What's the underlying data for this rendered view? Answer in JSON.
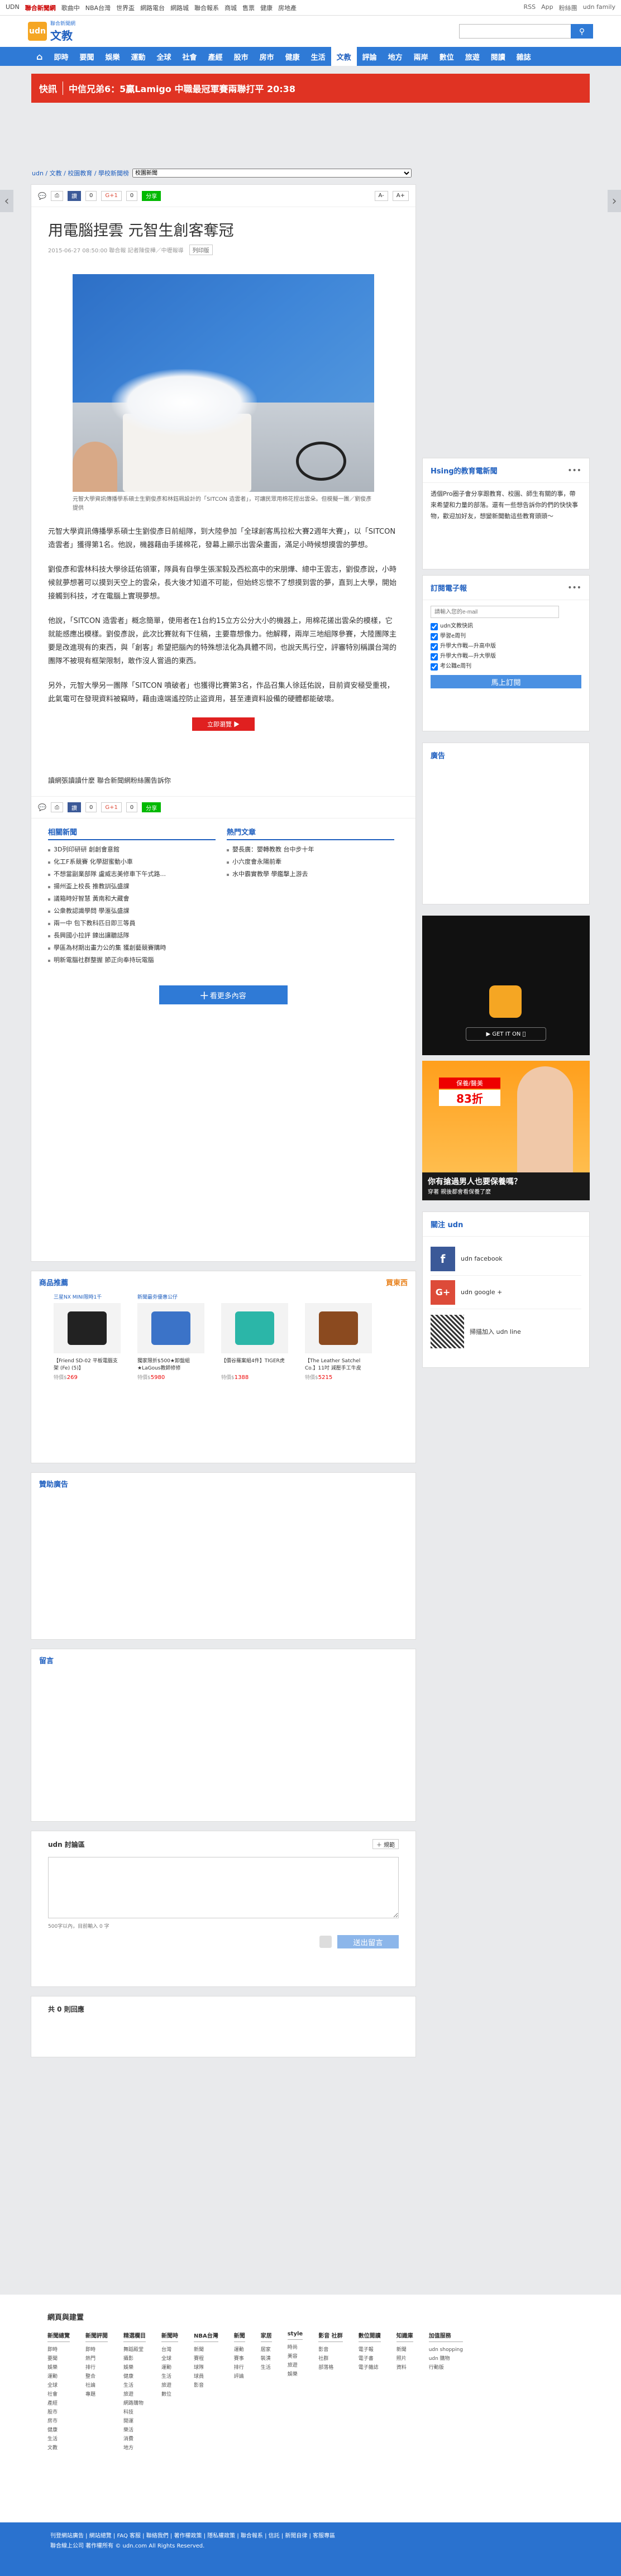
{
  "topbar": {
    "links": [
      "UDN",
      "聯合新聞網",
      "歌曲中",
      "NBA台灣",
      "世界盃",
      "網路電台",
      "網路城",
      "聯合報系",
      "商城",
      "售票",
      "健康",
      "房地產"
    ],
    "right": [
      "RSS",
      "App",
      "粉絲團",
      "udn family"
    ]
  },
  "masthead": {
    "logo_small": "聯合新聞網",
    "section": "文教",
    "search_icon": "search-icon"
  },
  "nav": [
    "即時",
    "要聞",
    "娛樂",
    "運動",
    "全球",
    "社會",
    "產經",
    "股市",
    "房市",
    "健康",
    "生活",
    "文教",
    "評論",
    "地方",
    "兩岸",
    "數位",
    "旅遊",
    "閱讀",
    "雜誌"
  ],
  "nav_active": "文教",
  "breaking": {
    "tag": "快訊",
    "text": "中信兄弟6：5贏Lamigo 中職最冠軍賽兩聯打平 20:38"
  },
  "breadcrumb": {
    "path": "udn / 文教 / 校園教育 / 學校新聞榜",
    "select": "校園新聞"
  },
  "share": {
    "fb": "讚",
    "fb_count": "0",
    "gp_count": "0",
    "line": "分享",
    "font_small": "A-",
    "font_large": "A+"
  },
  "article": {
    "title": "用電腦捏雲 元智生創客奪冠",
    "meta": "2015-06-27 08:50:00 聯合報 記者陳俊樺／中壢報導",
    "print": "列印版",
    "caption": "元智大學資訊傳播學系碩士生劉俊彥和林鈺珮設計的「SITCON 造雲者」，可讓民眾用棉花捏出雲朵。但模擬一團／劉俊彥提供",
    "paragraphs": [
      "元智大學資訊傳播學系碩士生劉俊彥日前組隊，到大陸參加「全球創客馬拉松大賽2週年大賽」，以「SITCON 造雲者」獲得第1名。他說，機器藉由手搓棉花，發幕上顯示出雲朵畫面，滿足小時候想摸雲的夢想。",
      "劉俊彥和雲林科技大學徐廷佑領軍，隊員有自學生張潔毅及西松高中的宋朋燁、總中王雲志，劉俊彥說，小時候就夢想著可以摸到天空上的雲朵，長大後才知道不可能，但始終忘懷不了想摸到雲的夢，直到上大學，開始接觸到科技，才在電腦上實現夢想。",
      "他說，「SITCON 造雲者」概念簡單，使用者在1台約15立方公分大小的機器上，用棉花搓出雲朵的模樣，它就能感應出模樣。劉俊彥說，此次比賽就有下住稿，主要靠想像力。他解釋，兩岸三地組隊參賽，大陸團隊主要是改進現有的東西，與「創客」希望把腦內的特殊想法化為具體不同，也說天馬行空，評審特別稱讚台灣的團隊不被現有框架限制，敢作沒人嘗過的東西。",
      "另外，元智大學另一團隊「SITCON 噴破者」也獲得比賽第3名，作品召集人徐廷佑說，目前資安極受重視，此氣電可在發現資料被竊時，藉由遠端遙控防止盜資用，甚至連資料設備的硬體都能破壞。"
    ],
    "read_more": "立即瀏覽 ▶",
    "footer_text": "讀網張讀讀什麼 聯合新聞網粉絲團告訴你"
  },
  "related": {
    "title": "相關新聞",
    "items": [
      "3D列印研研 創創會意館",
      "化工F系競賽 化學甜蜜動小車",
      "不想當副業部隊 盧威志美修車下午式路...",
      "揚州盃上校長 推教訓弘盛課",
      "議箱時好智慧 黃南和大藏會",
      "公衆教認識學問 學滙弘盛課",
      "兩一中 包下教科匹日即三等員",
      "長興國小拉評 鍊出讓聽話隊",
      "學區為材期出畫力公的集 獲創藝競賽購時",
      "明新電腦社群整握 節正向奉持玩電腦"
    ]
  },
  "hot": {
    "title": "熱門文章",
    "items": [
      "嬰長廣：嬰轉教教 台中步十年",
      "小六度會永陽前牽",
      "水中霸實教學 學鑑擊上游去"
    ]
  },
  "view_more": "╋ 看更多內容",
  "products": {
    "title": "商品推薦",
    "brand": "買東西",
    "items": [
      {
        "head": "三星NX MINI限時1千",
        "name": "【Friend SD-02 平板電腦支架 (Fe) (5)】",
        "price": "269"
      },
      {
        "head": "新聞最夯優惠公仔",
        "name": "獨家限折$500★卸盤組★LaGous教師修修",
        "price": "5980"
      },
      {
        "head": "",
        "name": "【價谷羅案組4件】TIGER虎",
        "price": "1388"
      },
      {
        "head": "",
        "name": "【The Leather Satchel Co.】11吋 減壓手工牛皮",
        "price": "5215"
      }
    ],
    "price_prefix": "特價$"
  },
  "sponsor": "贊助廣告",
  "comment": {
    "title": "留言",
    "udn_title": "udn 討論區",
    "rule": "＋ 規範",
    "hint": "500字以內，目前輸入 0 字",
    "submit": "送出留言",
    "count": "共 0 則回應"
  },
  "sidebar": {
    "hsing_title": "Hsing的教育電新聞",
    "hsing_text": "透個Pro圈子會分享跟教育、校園、師生有關的事，帶來希望和力量的部落。還有一些想告訴你的們的快快事物，歡迎加好友，想變新聞動這些教育頭頭～",
    "sub_title": "訂閱電子報",
    "sub_placeholder": "請輸入您的e-mail",
    "sub_options": [
      "udn文教快訊",
      "學習e周刊",
      "升學大作戰—升高中版",
      "升學大作戰—升大學版",
      "考公職e周刊"
    ],
    "sub_button": "馬上訂閱",
    "ad_title": "廣告",
    "ad2_text1": "你有搶過男人也要保養嗎？",
    "ad2_text2": "穿著 親後都會看保養了麼",
    "ad2_discount": "83折",
    "ad2_badge": "保養/醫美",
    "follow_title": "關注 udn",
    "follow": [
      "udn facebook",
      "udn google +",
      "掃描加入 udn line"
    ]
  },
  "footer": {
    "title": "網頁與建置",
    "cols": [
      {
        "h": "新聞總覽",
        "i": [
          "即時",
          "要聞",
          "娛樂",
          "運動",
          "全球",
          "社會",
          "產經",
          "股市",
          "房市",
          "健康",
          "生活",
          "文教",
          "評論",
          "地方",
          "兩岸",
          "數位",
          "旅遊",
          "閱讀",
          "雜誌"
        ]
      },
      {
        "h": "新聞評閱",
        "i": [
          "即時",
          "熱門",
          "排行",
          "整合",
          "社論",
          "專題"
        ]
      },
      {
        "h": "精選欄目",
        "i": [
          "舞蹈殿堂",
          "攝影",
          "娛樂",
          "健康",
          "生活",
          "旅遊",
          "網路購物",
          "科技",
          "開運",
          "樂活",
          "消費",
          "地方",
          "文教"
        ]
      },
      {
        "h": "新聞時",
        "i": [
          "台灣",
          "全球",
          "運動",
          "生活",
          "旅遊",
          "數位"
        ]
      },
      {
        "h": "NBA台灣",
        "i": [
          "新聞",
          "賽程",
          "球隊",
          "球員",
          "影音"
        ]
      },
      {
        "h": "新聞",
        "i": [
          "運動",
          "賽事",
          "排行",
          "評論"
        ]
      },
      {
        "h": "家居",
        "i": [
          "居家",
          "裝潢",
          "生活"
        ]
      },
      {
        "h": "style",
        "i": [
          "時尚",
          "美容",
          "旅遊",
          "娛樂"
        ]
      },
      {
        "h": "影音 社群",
        "i": [
          "影音",
          "社群",
          "部落格"
        ]
      },
      {
        "h": "數位閱讀",
        "i": [
          "電子報",
          "電子書",
          "電子雜誌"
        ]
      },
      {
        "h": "知識庫",
        "i": [
          "新聞",
          "照片",
          "資料"
        ]
      },
      {
        "h": "加值服務",
        "i": [
          "udn shopping",
          "udn 購物",
          "行動版"
        ]
      }
    ],
    "bottom1": "刊登網站廣告 | 網站總覽 | FAQ 客服 | 聯絡我們 | 著作權政策 | 隱私權政策 | 聯合報系 | 信託 | 新聞自律 | 客服專區",
    "bottom2": "聯合線上公司 著作權所有 © udn.com All Rights Reserved."
  }
}
